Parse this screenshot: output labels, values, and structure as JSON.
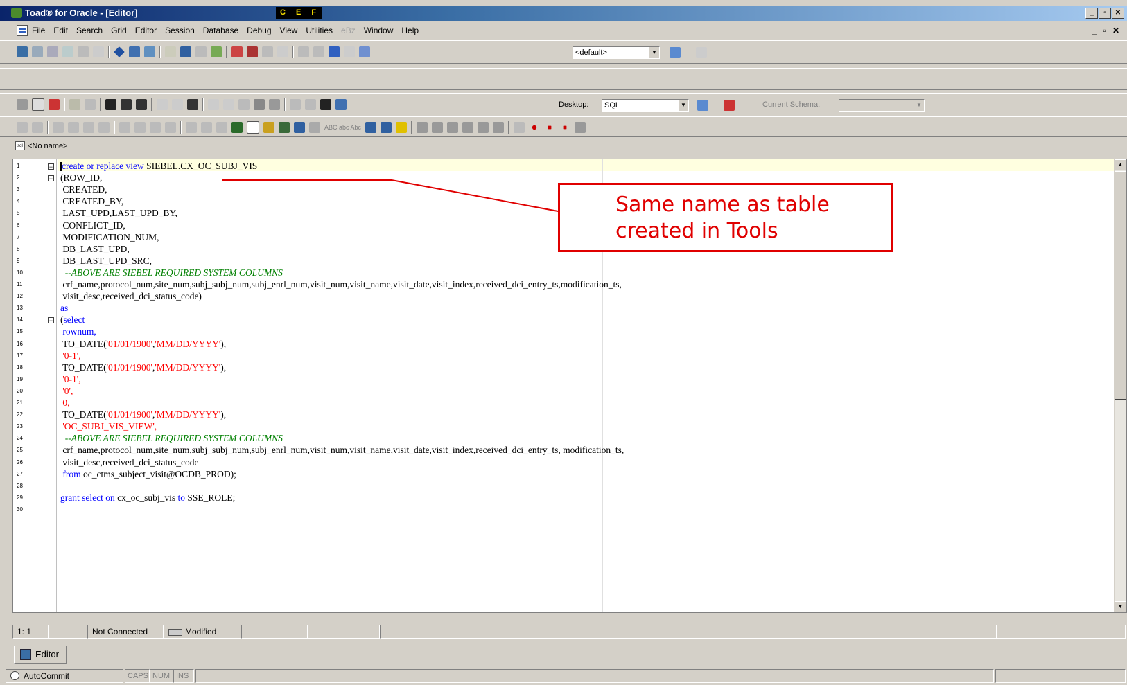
{
  "window": {
    "title": "Toad® for Oracle - [Editor]",
    "badge": "C E F",
    "controls": [
      "_",
      "▫",
      "✕"
    ],
    "mdi_controls": "_ ▫ ✕"
  },
  "menu": {
    "items": [
      "File",
      "Edit",
      "Search",
      "Grid",
      "Editor",
      "Session",
      "Database",
      "Debug",
      "View",
      "Utilities",
      "eBz",
      "Window",
      "Help"
    ]
  },
  "toolbar1": {
    "combo_value": "<default>"
  },
  "toolbar3": {
    "desktop_label": "Desktop:",
    "desktop_value": "SQL",
    "schema_label": "Current Schema:",
    "schema_value": ""
  },
  "toolbar4": {
    "case_buttons": "ABC abc Abc"
  },
  "tabs": {
    "doc_tab": "<No name>"
  },
  "editor": {
    "lines": [
      {
        "n": "1",
        "parts": [
          {
            "t": "create or replace view ",
            "c": "kw"
          },
          {
            "t": "SIEBEL.CX_OC_SUBJ_VIS",
            "c": "id"
          }
        ]
      },
      {
        "n": "2",
        "parts": [
          {
            "t": "(ROW_ID,",
            "c": "id"
          }
        ]
      },
      {
        "n": "3",
        "parts": [
          {
            "t": " CREATED,",
            "c": "id"
          }
        ]
      },
      {
        "n": "4",
        "parts": [
          {
            "t": " CREATED_BY,",
            "c": "id"
          }
        ]
      },
      {
        "n": "5",
        "parts": [
          {
            "t": " LAST_UPD,LAST_UPD_BY,",
            "c": "id"
          }
        ]
      },
      {
        "n": "6",
        "parts": [
          {
            "t": " CONFLICT_ID,",
            "c": "id"
          }
        ]
      },
      {
        "n": "7",
        "parts": [
          {
            "t": " MODIFICATION_NUM,",
            "c": "id"
          }
        ]
      },
      {
        "n": "8",
        "parts": [
          {
            "t": " DB_LAST_UPD,",
            "c": "id"
          }
        ]
      },
      {
        "n": "9",
        "parts": [
          {
            "t": " DB_LAST_UPD_SRC,",
            "c": "id"
          }
        ]
      },
      {
        "n": "10",
        "parts": [
          {
            "t": "  --ABOVE ARE SIEBEL REQUIRED SYSTEM COLUMNS",
            "c": "cmt"
          }
        ]
      },
      {
        "n": "11",
        "parts": [
          {
            "t": " crf_name,protocol_num,site_num,subj_subj_num,subj_enrl_num,visit_num,visit_name,visit_date,visit_index,received_dci_entry_ts,modification_ts,",
            "c": "id"
          }
        ]
      },
      {
        "n": "12",
        "parts": [
          {
            "t": " visit_desc,received_dci_status_code)",
            "c": "id"
          }
        ]
      },
      {
        "n": "13",
        "parts": [
          {
            "t": "as",
            "c": "kw"
          }
        ]
      },
      {
        "n": "14",
        "parts": [
          {
            "t": "(",
            "c": "id"
          },
          {
            "t": "select",
            "c": "kw"
          }
        ]
      },
      {
        "n": "15",
        "parts": [
          {
            "t": " rownum,",
            "c": "kw"
          }
        ]
      },
      {
        "n": "16",
        "parts": [
          {
            "t": " TO_DATE(",
            "c": "id"
          },
          {
            "t": "'01/01/1900'",
            "c": "str"
          },
          {
            "t": ",",
            "c": "id"
          },
          {
            "t": "'MM/DD/YYYY'",
            "c": "str"
          },
          {
            "t": "),",
            "c": "id"
          }
        ]
      },
      {
        "n": "17",
        "parts": [
          {
            "t": " '0-1',",
            "c": "str"
          }
        ]
      },
      {
        "n": "18",
        "parts": [
          {
            "t": " TO_DATE(",
            "c": "id"
          },
          {
            "t": "'01/01/1900'",
            "c": "str"
          },
          {
            "t": ",",
            "c": "id"
          },
          {
            "t": "'MM/DD/YYYY'",
            "c": "str"
          },
          {
            "t": "),",
            "c": "id"
          }
        ]
      },
      {
        "n": "19",
        "parts": [
          {
            "t": " '0-1',",
            "c": "str"
          }
        ]
      },
      {
        "n": "20",
        "parts": [
          {
            "t": " '0',",
            "c": "str"
          }
        ]
      },
      {
        "n": "21",
        "parts": [
          {
            "t": " 0,",
            "c": "str"
          }
        ]
      },
      {
        "n": "22",
        "parts": [
          {
            "t": " TO_DATE(",
            "c": "id"
          },
          {
            "t": "'01/01/1900'",
            "c": "str"
          },
          {
            "t": ",",
            "c": "id"
          },
          {
            "t": "'MM/DD/YYYY'",
            "c": "str"
          },
          {
            "t": "),",
            "c": "id"
          }
        ]
      },
      {
        "n": "23",
        "parts": [
          {
            "t": " 'OC_SUBJ_VIS_VIEW',",
            "c": "str"
          }
        ]
      },
      {
        "n": "24",
        "parts": [
          {
            "t": "  --ABOVE ARE SIEBEL REQUIRED SYSTEM COLUMNS",
            "c": "cmt"
          }
        ]
      },
      {
        "n": "25",
        "parts": [
          {
            "t": " crf_name,protocol_num,site_num,subj_subj_num,subj_enrl_num,visit_num,visit_name,visit_date,visit_index,received_dci_entry_ts, modification_ts,",
            "c": "id"
          }
        ]
      },
      {
        "n": "26",
        "parts": [
          {
            "t": " visit_desc,received_dci_status_code",
            "c": "id"
          }
        ]
      },
      {
        "n": "27",
        "parts": [
          {
            "t": " from ",
            "c": "kw"
          },
          {
            "t": "oc_ctms_subject_visit@OCDB_PROD);",
            "c": "id"
          }
        ]
      },
      {
        "n": "28",
        "parts": []
      },
      {
        "n": "29",
        "parts": [
          {
            "t": "grant select on ",
            "c": "kw"
          },
          {
            "t": "cx_oc_subj_vis ",
            "c": "id"
          },
          {
            "t": "to ",
            "c": "kw"
          },
          {
            "t": "SSE_ROLE;",
            "c": "id"
          }
        ]
      },
      {
        "n": "30",
        "parts": []
      }
    ]
  },
  "annotation": {
    "text_line1": "Same name as table",
    "text_line2": "created in Tools"
  },
  "statusbar": {
    "position": "1:  1",
    "connection": "Not Connected",
    "modified": "Modified"
  },
  "bottom_tab": {
    "label": "Editor"
  },
  "bottom_status": {
    "autocommit": "AutoCommit",
    "caps": "CAPS",
    "num": "NUM",
    "ins": "INS"
  },
  "colors": {
    "keyword": "#0000ff",
    "string": "#ff0000",
    "comment": "#008000",
    "annotation": "#e00000"
  }
}
